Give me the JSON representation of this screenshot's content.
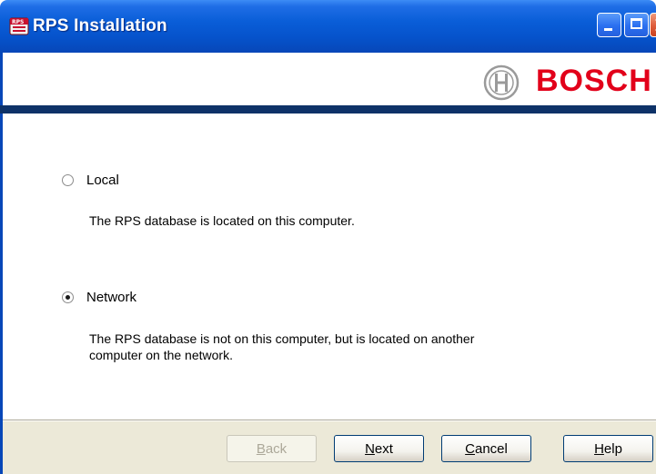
{
  "window": {
    "title": "RPS Installation",
    "app_icon": "rps-app-icon",
    "controls": [
      "minimize-icon",
      "maximize-icon",
      "close-icon"
    ]
  },
  "header": {
    "brand": "BOSCH",
    "brand_color": "#e2001a"
  },
  "options": [
    {
      "label": "Local",
      "selected": false,
      "description": "The RPS database is located on this computer."
    },
    {
      "label": "Network",
      "selected": true,
      "description_line1": "The RPS database is not on this computer, but is located on another",
      "description_line2": "computer on the network."
    }
  ],
  "buttons": {
    "back": {
      "first": "B",
      "rest": "ack",
      "enabled": false
    },
    "next": {
      "first": "N",
      "rest": "ext",
      "enabled": true
    },
    "cancel": {
      "first": "C",
      "rest": "ancel",
      "enabled": true
    },
    "help": {
      "first": "H",
      "rest": "elp",
      "enabled": true
    }
  },
  "colors": {
    "titlebar": "#0653cc",
    "header_rule": "#0e3268",
    "footer_bg": "#ece9d8"
  }
}
